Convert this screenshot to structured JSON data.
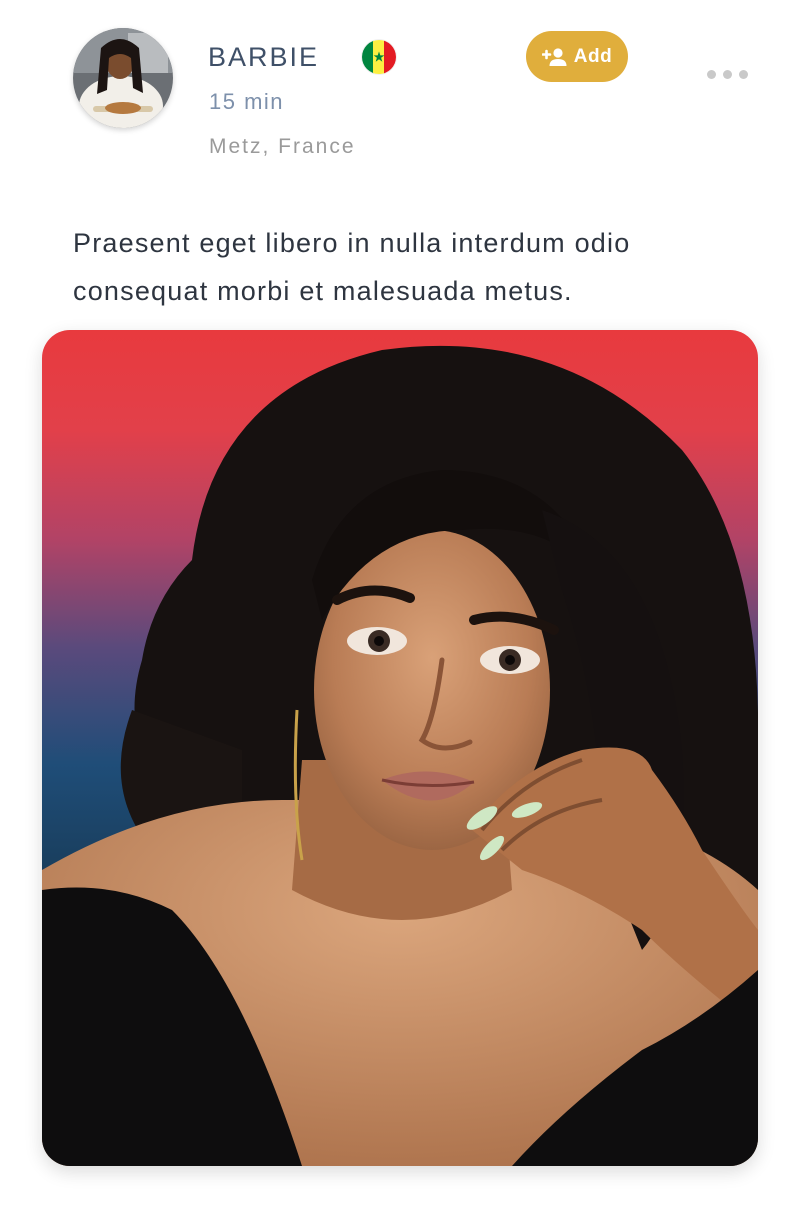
{
  "post": {
    "author": {
      "name": "BARBIE",
      "time_ago": "15 min",
      "location": "Metz, France",
      "flag": "senegal-flag-icon"
    },
    "actions": {
      "add_label": "Add",
      "add_icon": "add-person-icon",
      "more_icon": "more-horizontal-icon"
    },
    "caption": "Praesent eget libero in nulla interdum odio consequat morbi et malesuada metus.",
    "photo": {
      "subject": "portrait-photo"
    }
  },
  "colors": {
    "accent": "#e0ae3c",
    "username": "#3f5068",
    "time": "#7d90ab",
    "location": "#9a9a9a",
    "caption": "#2e3540"
  }
}
